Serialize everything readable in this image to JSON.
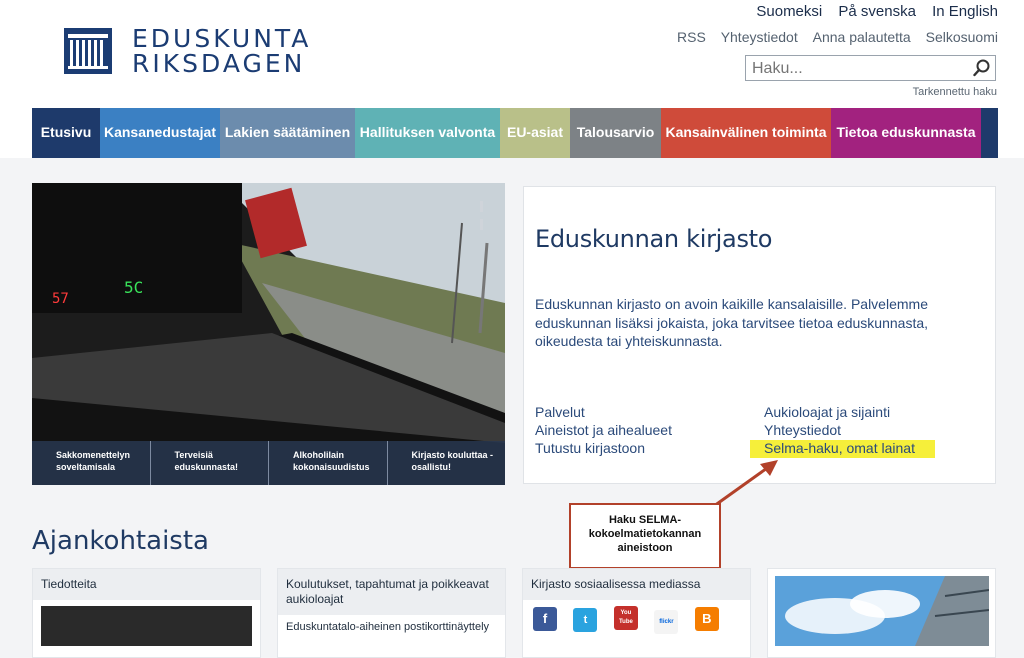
{
  "logo": {
    "line1": "EDUSKUNTA",
    "line2": "RIKSDAGEN"
  },
  "languages": [
    "Suomeksi",
    "På svenska",
    "In English"
  ],
  "utility_links": [
    "RSS",
    "Yhteystiedot",
    "Anna palautetta",
    "Selkosuomi"
  ],
  "search": {
    "placeholder": "Haku...",
    "advanced": "Tarkennettu haku"
  },
  "nav": [
    {
      "label": "Etusivu",
      "color": "#1e3a6b"
    },
    {
      "label": "Kansanedustajat",
      "color": "#3b80c3"
    },
    {
      "label": "Lakien säätäminen",
      "color": "#6c8cad"
    },
    {
      "label": "Hallituksen valvonta",
      "color": "#5fb2b5"
    },
    {
      "label": "EU-asiat",
      "color": "#b9c089"
    },
    {
      "label": "Talousarvio",
      "color": "#7d8286"
    },
    {
      "label": "Kansainvälinen toiminta",
      "color": "#cf4b3a"
    },
    {
      "label": "Tietoa eduskunnasta",
      "color": "#a2227f"
    }
  ],
  "hero": {
    "tabs": [
      "Sakkomenettelyn soveltamisala",
      "Terveisiä eduskunnasta!",
      "Alkoholilain kokonaisuudistus",
      "Kirjasto kouluttaa - osallistu!"
    ]
  },
  "library": {
    "title": "Eduskunnan kirjasto",
    "description": "Eduskunnan kirjasto on avoin kaikille kansalaisille. Palvelemme eduskunnan lisäksi jokaista, joka tarvitsee tietoa eduskunnasta, oikeudesta tai yhteiskunnasta.",
    "links_left": [
      "Palvelut",
      "Aineistot ja aihealueet",
      "Tutustu kirjastoon"
    ],
    "links_right": [
      "Aukioloajat ja sijainti",
      "Yhteystiedot",
      "Selma-haku, omat lainat"
    ]
  },
  "callout": {
    "text": "Haku SELMA-kokoelmatietokannan aineistoon"
  },
  "news": {
    "heading": "Ajankohtaista",
    "cards": [
      {
        "title": "Tiedotteita",
        "sub": ""
      },
      {
        "title": "Koulutukset, tapahtumat ja poikkeavat aukioloajat",
        "sub": "Eduskuntatalo-aiheinen postikorttinäyttely"
      },
      {
        "title": "Kirjasto sosiaalisessa mediassa",
        "sub": ""
      }
    ],
    "social": [
      "f",
      "t",
      "You Tube",
      "flickr",
      "B"
    ]
  },
  "colors": {
    "brand": "#1b3c73",
    "highlight": "#f6ef3a",
    "callout_border": "#b2412a"
  }
}
